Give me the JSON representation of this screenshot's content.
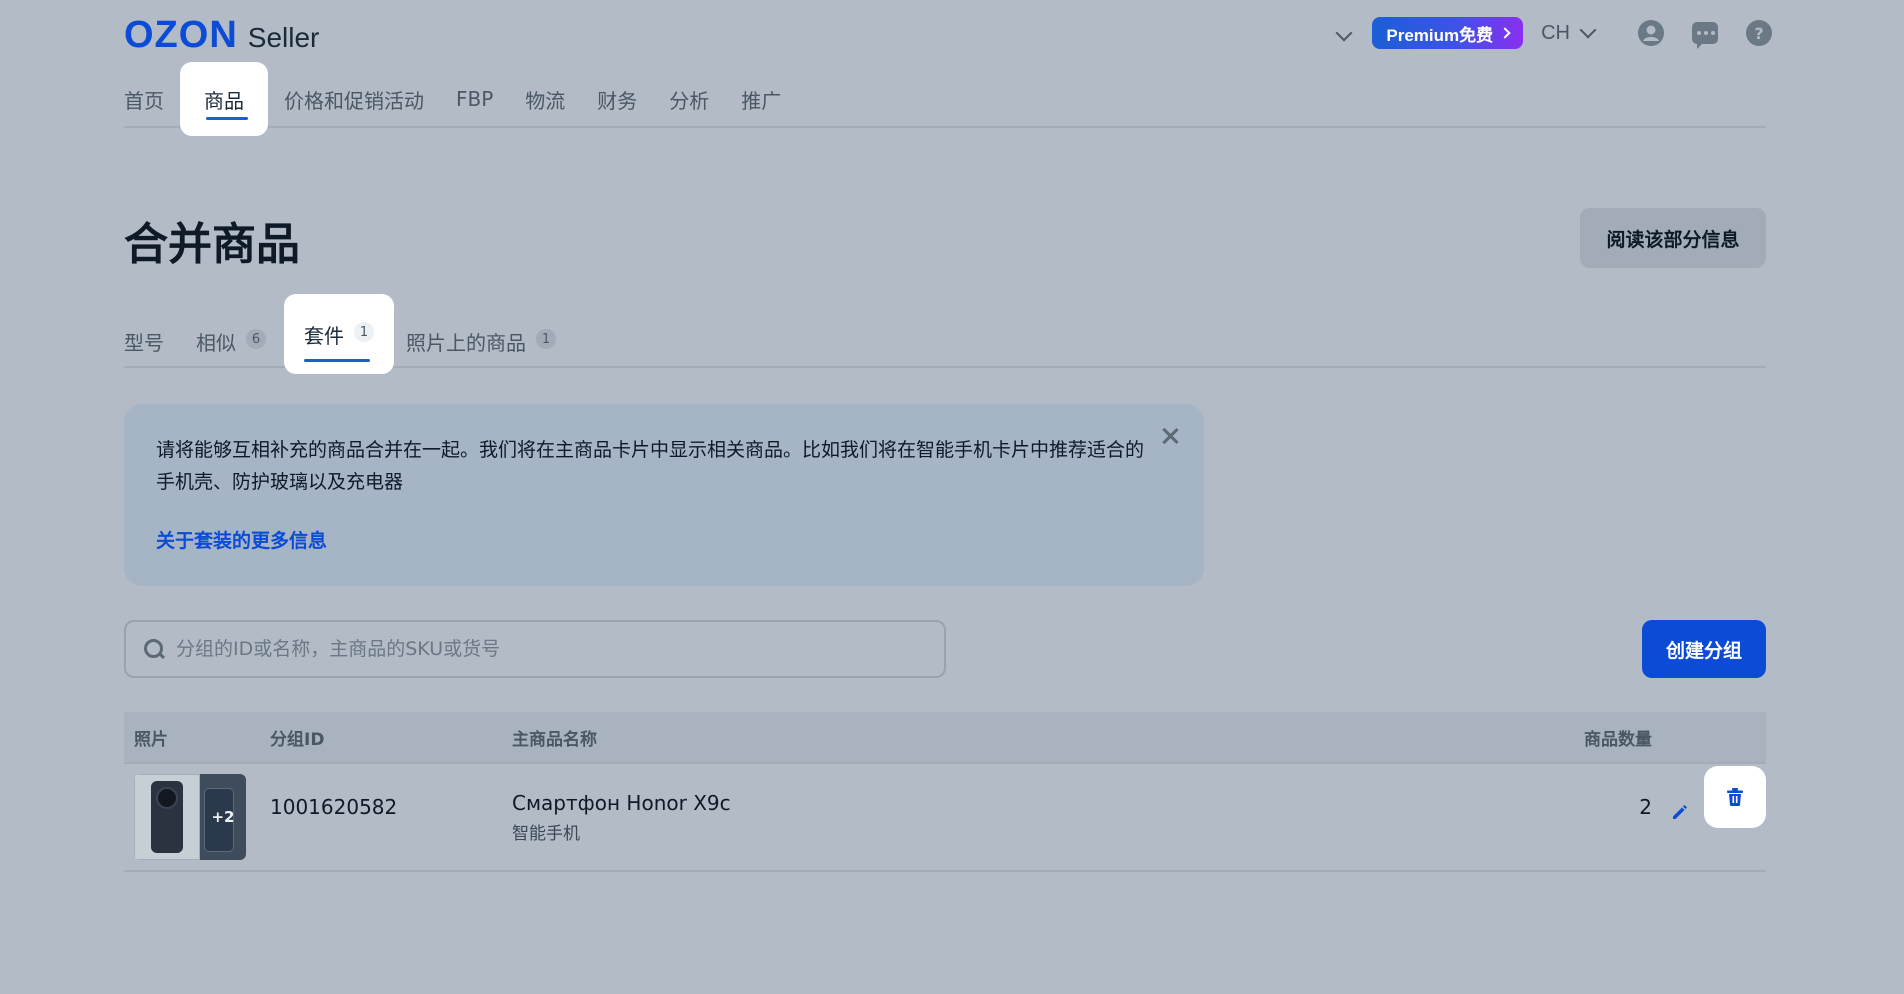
{
  "header": {
    "logo_brand": "OZON",
    "logo_product": "Seller",
    "premium_label": "Premium免费",
    "language": "CH",
    "icons": [
      "chevron-down-icon",
      "user-icon",
      "chat-icon",
      "help-icon"
    ],
    "help_glyph": "?"
  },
  "nav": {
    "items": [
      {
        "label": "首页"
      },
      {
        "label": "商品"
      },
      {
        "label": "价格和促销活动"
      },
      {
        "label": "FBP"
      },
      {
        "label": "物流"
      },
      {
        "label": "财务"
      },
      {
        "label": "分析"
      },
      {
        "label": "推广"
      }
    ],
    "active_index": 1
  },
  "page": {
    "title": "合并商品",
    "read_more_button": "阅读该部分信息"
  },
  "tabs": {
    "items": [
      {
        "label": "型号",
        "count": ""
      },
      {
        "label": "相似",
        "count": "6"
      },
      {
        "label": "套件",
        "count": "1"
      },
      {
        "label": "照片上的商品",
        "count": "1"
      }
    ],
    "active_index": 2
  },
  "banner": {
    "text": "请将能够互相补充的商品合并在一起。我们将在主商品卡片中显示相关商品。比如我们将在智能手机卡片中推荐适合的手机壳、防护玻璃以及充电器",
    "link": "关于套装的更多信息"
  },
  "search": {
    "placeholder": "分组的ID或名称，主商品的SKU或货号",
    "value": ""
  },
  "create_button": "创建分组",
  "table": {
    "columns": {
      "photo": "照片",
      "group_id": "分组ID",
      "main_product": "主商品名称",
      "count": "商品数量"
    },
    "rows": [
      {
        "photo_extra": "+2",
        "group_id": "1001620582",
        "product_name": "Смартфон Honor X9c",
        "product_category": "智能手机",
        "count": "2"
      }
    ]
  },
  "colors": {
    "accent": "#0b4bd6",
    "overlay_bg": "#b2bbc6",
    "premium_start": "#1b5fd6",
    "premium_end": "#8a2ff0"
  }
}
